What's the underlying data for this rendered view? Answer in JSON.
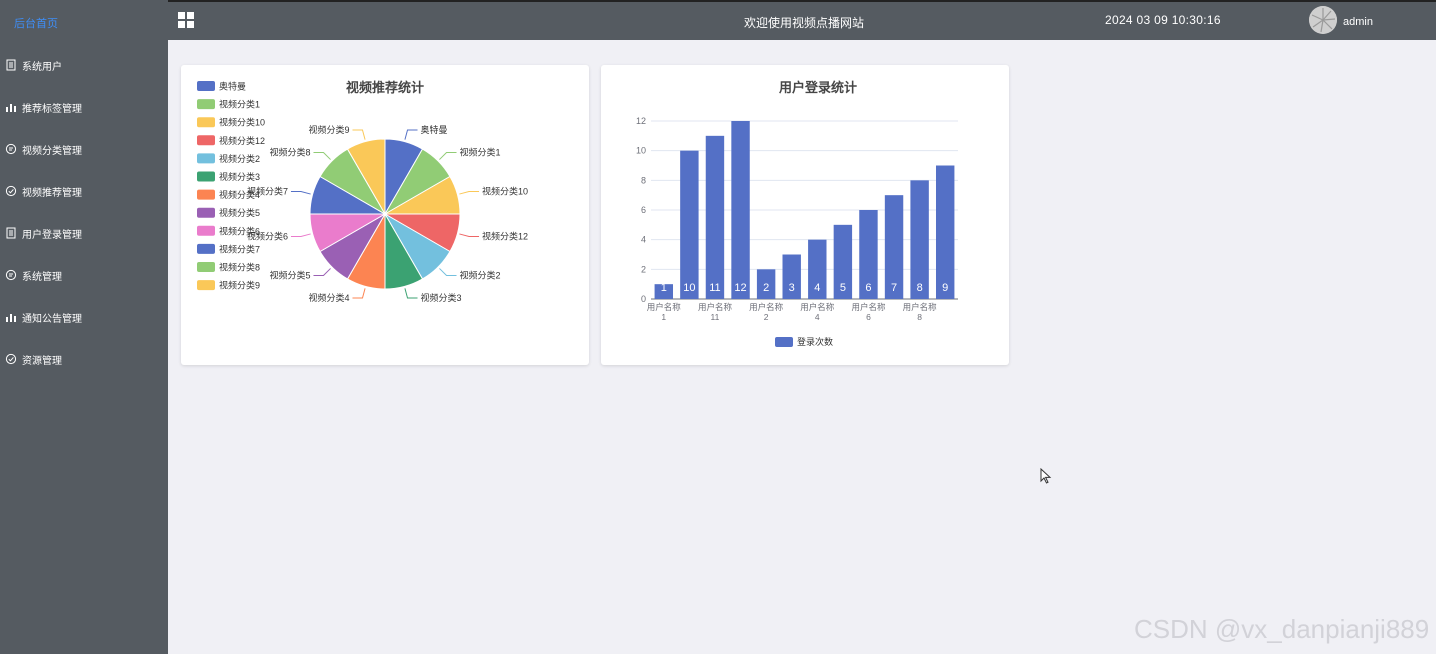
{
  "sidebar": {
    "home": "后台首页",
    "items": [
      {
        "label": "系统用户",
        "icon": "document-icon"
      },
      {
        "label": "推荐标签管理",
        "icon": "bar-chart-icon"
      },
      {
        "label": "视频分类管理",
        "icon": "chat-icon"
      },
      {
        "label": "视频推荐管理",
        "icon": "check-circle-icon"
      },
      {
        "label": "用户登录管理",
        "icon": "document-icon"
      },
      {
        "label": "系统管理",
        "icon": "chat-icon"
      },
      {
        "label": "通知公告管理",
        "icon": "bar-chart-icon"
      },
      {
        "label": "资源管理",
        "icon": "check-circle-icon"
      }
    ]
  },
  "header": {
    "title": "欢迎使用视频点播网站",
    "datetime": "2024 03 09 10:30:16",
    "username": "admin"
  },
  "colors": {
    "sidebar_bg": "#555b61",
    "home_link": "#3e8ef7",
    "bar_color": "#5470c6"
  },
  "chart_data": [
    {
      "type": "pie",
      "title": "视频推荐统计",
      "legend_placement": "top-left",
      "series": [
        {
          "name": "奥特曼",
          "value": 1,
          "color": "#5470c6"
        },
        {
          "name": "视频分类1",
          "value": 1,
          "color": "#91cc75"
        },
        {
          "name": "视频分类10",
          "value": 1,
          "color": "#fac858"
        },
        {
          "name": "视频分类12",
          "value": 1,
          "color": "#ee6666"
        },
        {
          "name": "视频分类2",
          "value": 1,
          "color": "#73c0de"
        },
        {
          "name": "视频分类3",
          "value": 1,
          "color": "#3ba272"
        },
        {
          "name": "视频分类4",
          "value": 1,
          "color": "#fc8452"
        },
        {
          "name": "视频分类5",
          "value": 1,
          "color": "#9a60b4"
        },
        {
          "name": "视频分类6",
          "value": 1,
          "color": "#ea7ccc"
        },
        {
          "name": "视频分类7",
          "value": 1,
          "color": "#5470c6"
        },
        {
          "name": "视频分类8",
          "value": 1,
          "color": "#91cc75"
        },
        {
          "name": "视频分类9",
          "value": 1,
          "color": "#fac858"
        }
      ]
    },
    {
      "type": "bar",
      "title": "用户登录统计",
      "legend": "登录次数",
      "legend_placement": "bottom",
      "ylim": [
        0,
        12
      ],
      "yticks": [
        0,
        2,
        4,
        6,
        8,
        10,
        12
      ],
      "grid": true,
      "values": [
        1,
        10,
        11,
        12,
        2,
        3,
        4,
        5,
        6,
        7,
        8,
        9
      ],
      "x_tick_labels": [
        {
          "index": 0,
          "line1": "用户名称",
          "line2": "1"
        },
        {
          "index": 2,
          "line1": "用户名称",
          "line2": "11"
        },
        {
          "index": 4,
          "line1": "用户名称",
          "line2": "2"
        },
        {
          "index": 6,
          "line1": "用户名称",
          "line2": "4"
        },
        {
          "index": 8,
          "line1": "用户名称",
          "line2": "6"
        },
        {
          "index": 10,
          "line1": "用户名称",
          "line2": "8"
        }
      ]
    }
  ],
  "watermark": "CSDN @vx_danpianji889"
}
